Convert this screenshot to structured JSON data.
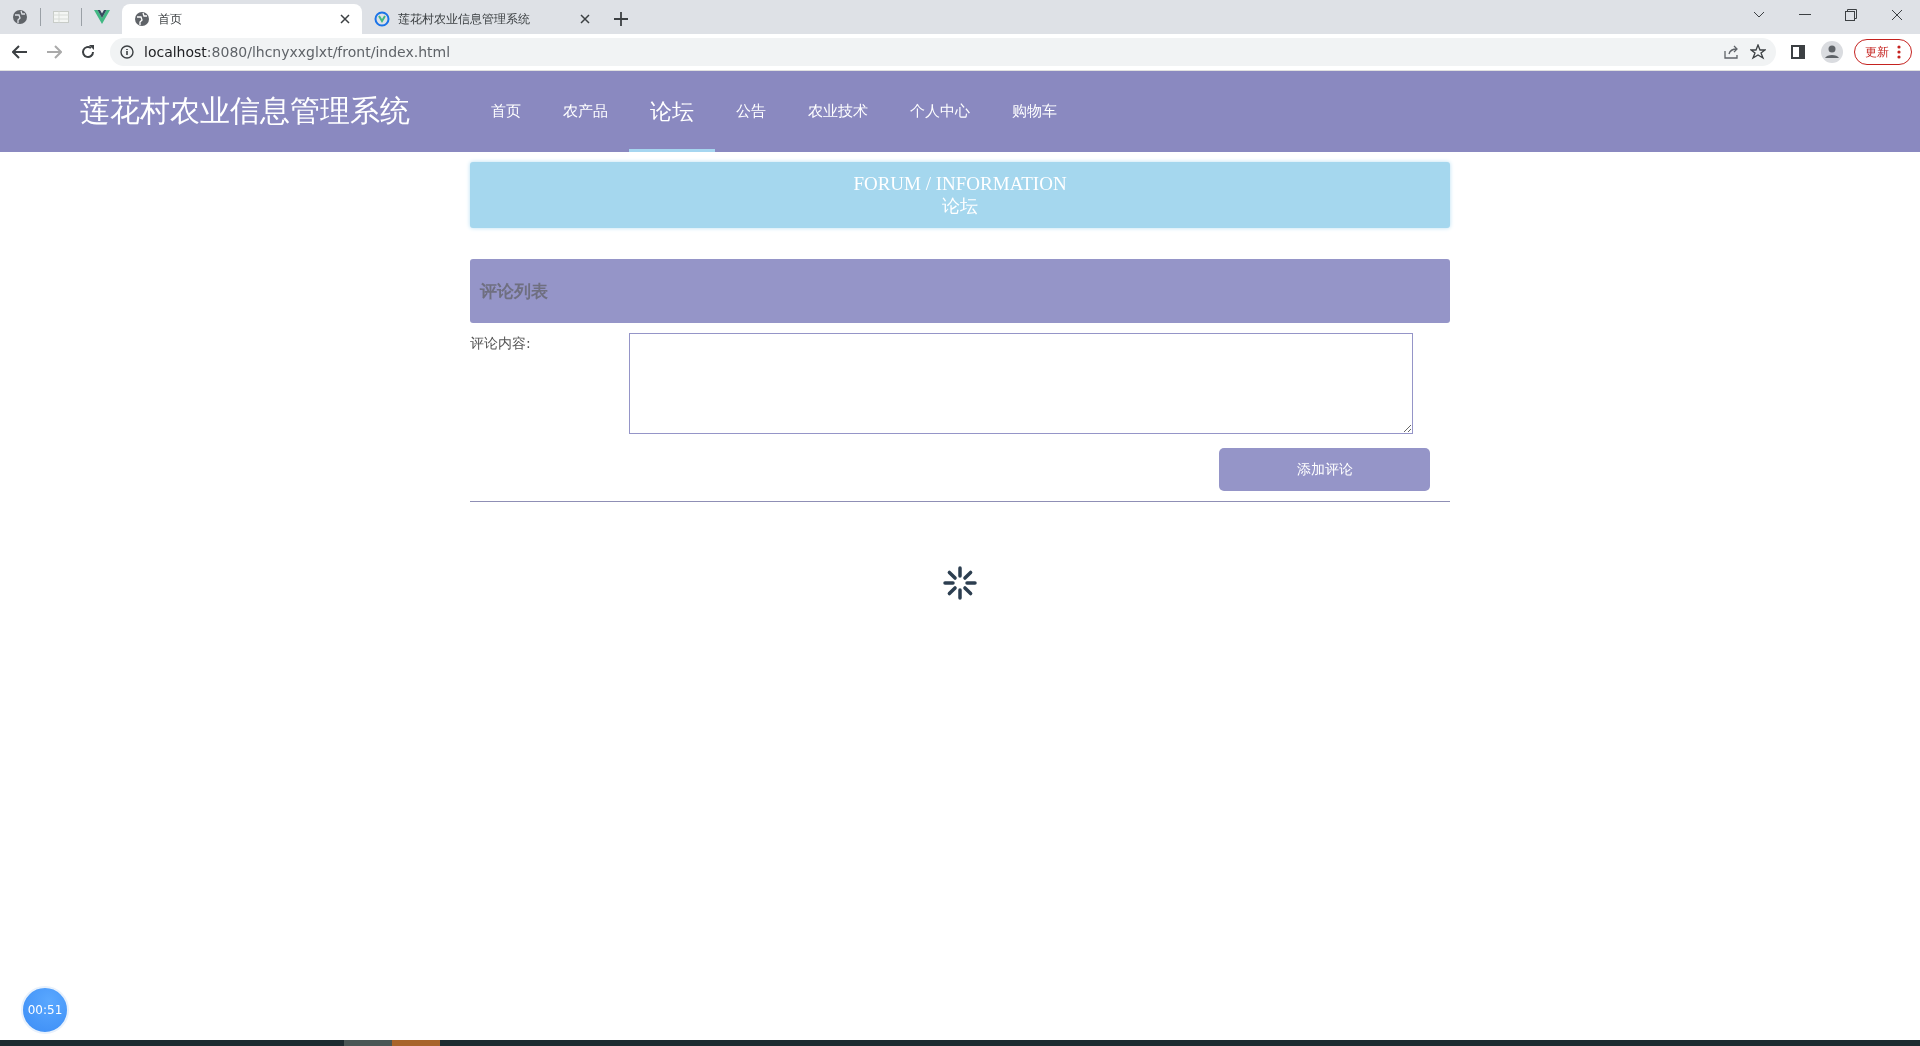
{
  "browser": {
    "tabs": [
      {
        "title": "首页",
        "selected": true
      },
      {
        "title": "莲花村农业信息管理系统",
        "selected": false
      }
    ],
    "url_host": "localhost",
    "url_path": ":8080/lhcnyxxglxt/front/index.html",
    "update_button": "更新"
  },
  "site": {
    "title": "莲花村农业信息管理系统",
    "nav": [
      {
        "label": "首页",
        "selected": false
      },
      {
        "label": "农产品",
        "selected": false
      },
      {
        "label": "论坛",
        "selected": true
      },
      {
        "label": "公告",
        "selected": false
      },
      {
        "label": "农业技术",
        "selected": false
      },
      {
        "label": "个人中心",
        "selected": false
      },
      {
        "label": "购物车",
        "selected": false
      }
    ]
  },
  "banner": {
    "title_en": "FORUM / INFORMATION",
    "title_cn": "论坛"
  },
  "comments": {
    "heading": "评论列表",
    "field_label": "评论内容:",
    "submit_button": "添加评论",
    "loading": true
  },
  "timer": "00:51"
}
